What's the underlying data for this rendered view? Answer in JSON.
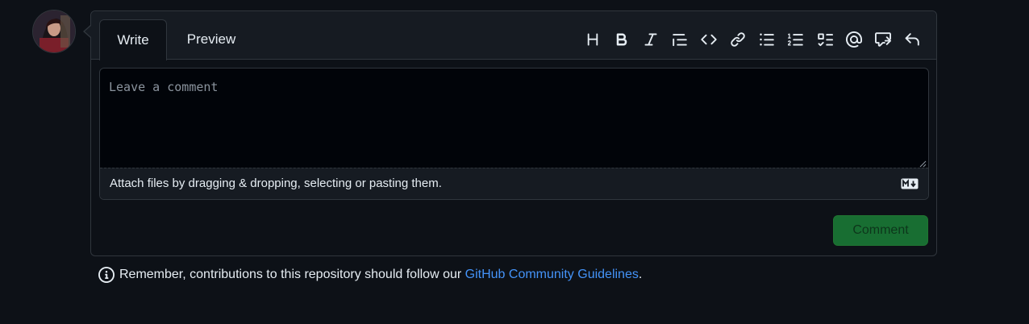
{
  "tabs": {
    "write": "Write",
    "preview": "Preview"
  },
  "toolbar": {
    "items": [
      "heading-icon",
      "bold-icon",
      "italic-icon",
      "quote-icon",
      "code-icon",
      "link-icon",
      "unordered-list-icon",
      "ordered-list-icon",
      "task-list-icon",
      "mention-icon",
      "reference-icon",
      "reply-icon"
    ]
  },
  "editor": {
    "placeholder": "Leave a comment",
    "attach_text": "Attach files by dragging & dropping, selecting or pasting them."
  },
  "actions": {
    "comment_label": "Comment"
  },
  "footer": {
    "prefix": "Remember, contributions to this repository should follow our ",
    "link_text": "GitHub Community Guidelines",
    "suffix": "."
  },
  "colors": {
    "background": "#0d1117",
    "accent_link": "#4493f8",
    "button_green": "#1a7f37"
  }
}
